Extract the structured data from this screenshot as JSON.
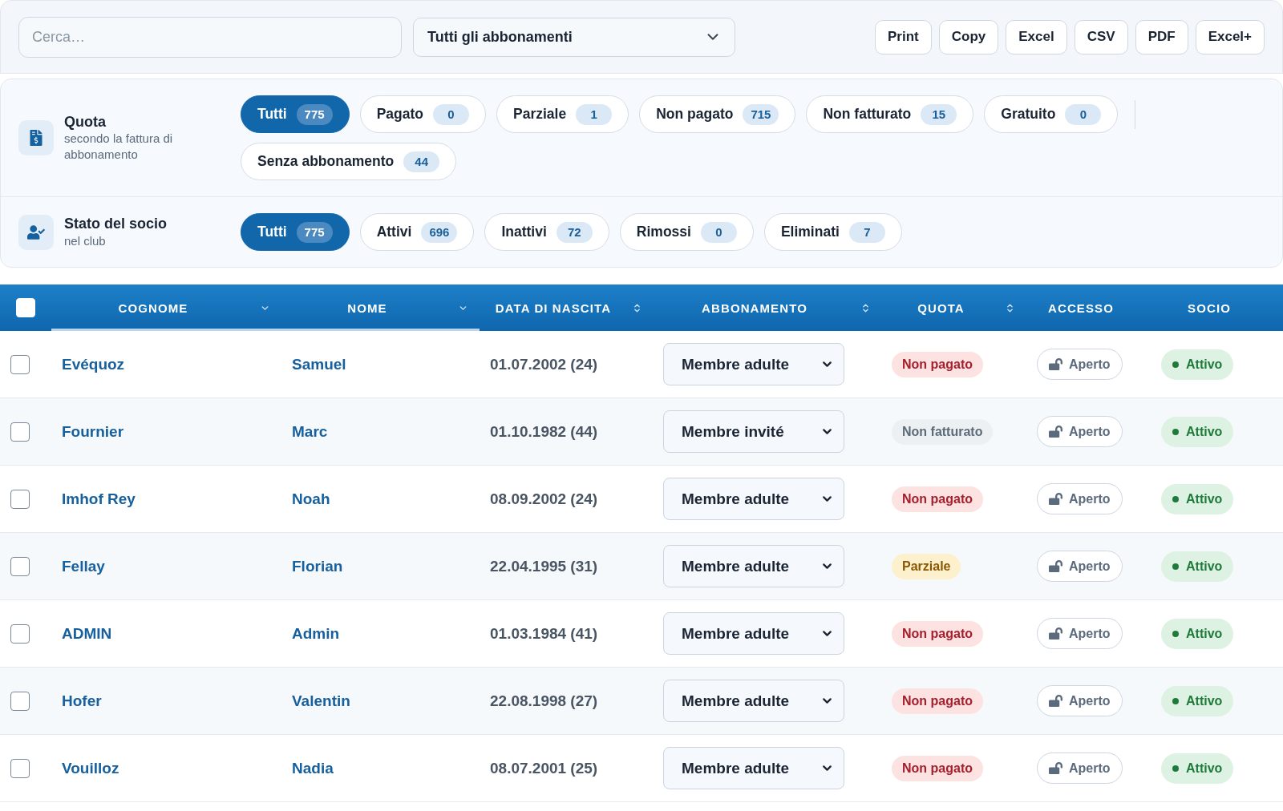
{
  "toolbar": {
    "search": {
      "placeholder": "Cerca…"
    },
    "subscription_filter": {
      "value": "Tutti gli abbonamenti"
    },
    "export_buttons": [
      "Print",
      "Copy",
      "Excel",
      "CSV",
      "PDF",
      "Excel+"
    ]
  },
  "filters": [
    {
      "kind": "quota",
      "title": "Quota",
      "subtitle": "secondo la fattura di abbonamento",
      "options": [
        {
          "label": "Tutti",
          "count": "775",
          "selected": true
        },
        {
          "label": "Pagato",
          "count": "0",
          "selected": false
        },
        {
          "label": "Parziale",
          "count": "1",
          "selected": false
        },
        {
          "label": "Non pagato",
          "count": "715",
          "selected": false
        },
        {
          "label": "Non fatturato",
          "count": "15",
          "selected": false
        },
        {
          "label": "Gratuito",
          "count": "0",
          "selected": false
        }
      ],
      "more_options": [
        {
          "label": "Senza abbonamento",
          "count": "44",
          "selected": false
        }
      ]
    },
    {
      "kind": "member",
      "title": "Stato del socio",
      "subtitle": "nel club",
      "options": [
        {
          "label": "Tutti",
          "count": "775",
          "selected": true
        },
        {
          "label": "Attivi",
          "count": "696",
          "selected": false
        },
        {
          "label": "Inattivi",
          "count": "72",
          "selected": false
        },
        {
          "label": "Rimossi",
          "count": "0",
          "selected": false
        },
        {
          "label": "Eliminati",
          "count": "7",
          "selected": false
        }
      ]
    }
  ],
  "table": {
    "select_all": {
      "checked": false
    },
    "columns": [
      {
        "label": "COGNOME",
        "sortable": true,
        "sorted": true
      },
      {
        "label": "NOME",
        "sortable": true,
        "sorted": true
      },
      {
        "label": "DATA DI NASCITA",
        "sortable": true,
        "sorted": false
      },
      {
        "label": "ABBONAMENTO",
        "sortable": true,
        "sorted": false
      },
      {
        "label": "QUOTA",
        "sortable": true,
        "sorted": false
      },
      {
        "label": "ACCESSO",
        "sortable": false,
        "sorted": false
      },
      {
        "label": "SOCIO",
        "sortable": false,
        "sorted": false
      }
    ],
    "rows": [
      {
        "selected": false,
        "surname": "Evéquoz",
        "name": "Samuel",
        "birth_date": "01.07.2002 (24)",
        "membership": "Membre adulte",
        "quota": {
          "label": "Non pagato",
          "kind": "unpaid"
        },
        "access": {
          "label": "Aperto",
          "kind": "open"
        },
        "member_status": {
          "label": "Attivo",
          "kind": "active"
        }
      },
      {
        "selected": false,
        "surname": "Fournier",
        "name": "Marc",
        "birth_date": "01.10.1982 (44)",
        "membership": "Membre invité",
        "quota": {
          "label": "Non fatturato",
          "kind": "uninvoiced"
        },
        "access": {
          "label": "Aperto",
          "kind": "open"
        },
        "member_status": {
          "label": "Attivo",
          "kind": "active"
        }
      },
      {
        "selected": false,
        "surname": "Imhof Rey",
        "name": "Noah",
        "birth_date": "08.09.2002 (24)",
        "membership": "Membre adulte",
        "quota": {
          "label": "Non pagato",
          "kind": "unpaid"
        },
        "access": {
          "label": "Aperto",
          "kind": "open"
        },
        "member_status": {
          "label": "Attivo",
          "kind": "active"
        }
      },
      {
        "selected": false,
        "surname": "Fellay",
        "name": "Florian",
        "birth_date": "22.04.1995 (31)",
        "membership": "Membre adulte",
        "quota": {
          "label": "Parziale",
          "kind": "partial"
        },
        "access": {
          "label": "Aperto",
          "kind": "open"
        },
        "member_status": {
          "label": "Attivo",
          "kind": "active"
        }
      },
      {
        "selected": false,
        "surname": "ADMIN",
        "name": "Admin",
        "birth_date": "01.03.1984 (41)",
        "membership": "Membre adulte",
        "quota": {
          "label": "Non pagato",
          "kind": "unpaid"
        },
        "access": {
          "label": "Aperto",
          "kind": "open"
        },
        "member_status": {
          "label": "Attivo",
          "kind": "active"
        }
      },
      {
        "selected": false,
        "surname": "Hofer",
        "name": "Valentin",
        "birth_date": "22.08.1998 (27)",
        "membership": "Membre adulte",
        "quota": {
          "label": "Non pagato",
          "kind": "unpaid"
        },
        "access": {
          "label": "Aperto",
          "kind": "open"
        },
        "member_status": {
          "label": "Attivo",
          "kind": "active"
        }
      },
      {
        "selected": false,
        "surname": "Vouilloz",
        "name": "Nadia",
        "birth_date": "08.07.2001 (25)",
        "membership": "Membre adulte",
        "quota": {
          "label": "Non pagato",
          "kind": "unpaid"
        },
        "access": {
          "label": "Aperto",
          "kind": "open"
        },
        "member_status": {
          "label": "Attivo",
          "kind": "active"
        }
      }
    ]
  }
}
